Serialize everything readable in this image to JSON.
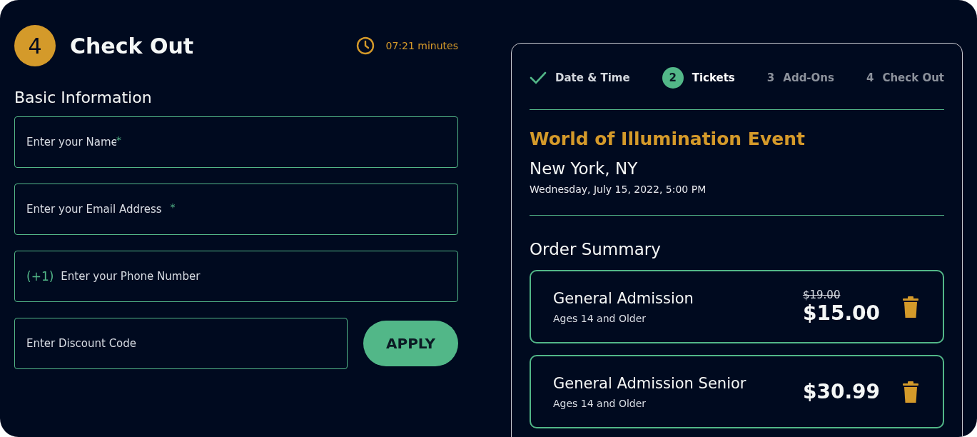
{
  "header": {
    "step_number": "4",
    "title": "Check Out",
    "timer": "07:21 minutes"
  },
  "basic_information": {
    "heading": "Basic Information",
    "fields": [
      {
        "kind": "text",
        "placeholder": "Enter your Name",
        "required_mark": "*"
      },
      {
        "kind": "text",
        "placeholder": "Enter your Email Address",
        "required_mark": "*"
      },
      {
        "kind": "phone",
        "prefix": "(+1)",
        "placeholder": "Enter your Phone Number"
      }
    ],
    "discount": {
      "placeholder": "Enter Discount Code",
      "button": "APPLY"
    }
  },
  "steps": [
    {
      "label": "Date & Time",
      "completed": true,
      "selected": false
    },
    {
      "number": "2",
      "label": "Tickets",
      "completed": false,
      "selected": true
    },
    {
      "number": "3",
      "label": "Add-Ons",
      "completed": false,
      "selected": false
    },
    {
      "number": "4",
      "label": "Check Out",
      "completed": false,
      "selected": false
    }
  ],
  "event": {
    "title": "World of Illumination Event",
    "location": "New York, NY",
    "datetime": "Wednesday, July 15, 2022, 5:00 PM"
  },
  "order_summary": {
    "heading": "Order Summary",
    "items": [
      {
        "name": "General Admission",
        "note": "Ages 14 and Older",
        "old_price": "$19.00",
        "price": "$15.00"
      },
      {
        "name": "General Admission Senior",
        "note": "Ages 14 and Older",
        "price": "$30.99"
      }
    ]
  }
}
